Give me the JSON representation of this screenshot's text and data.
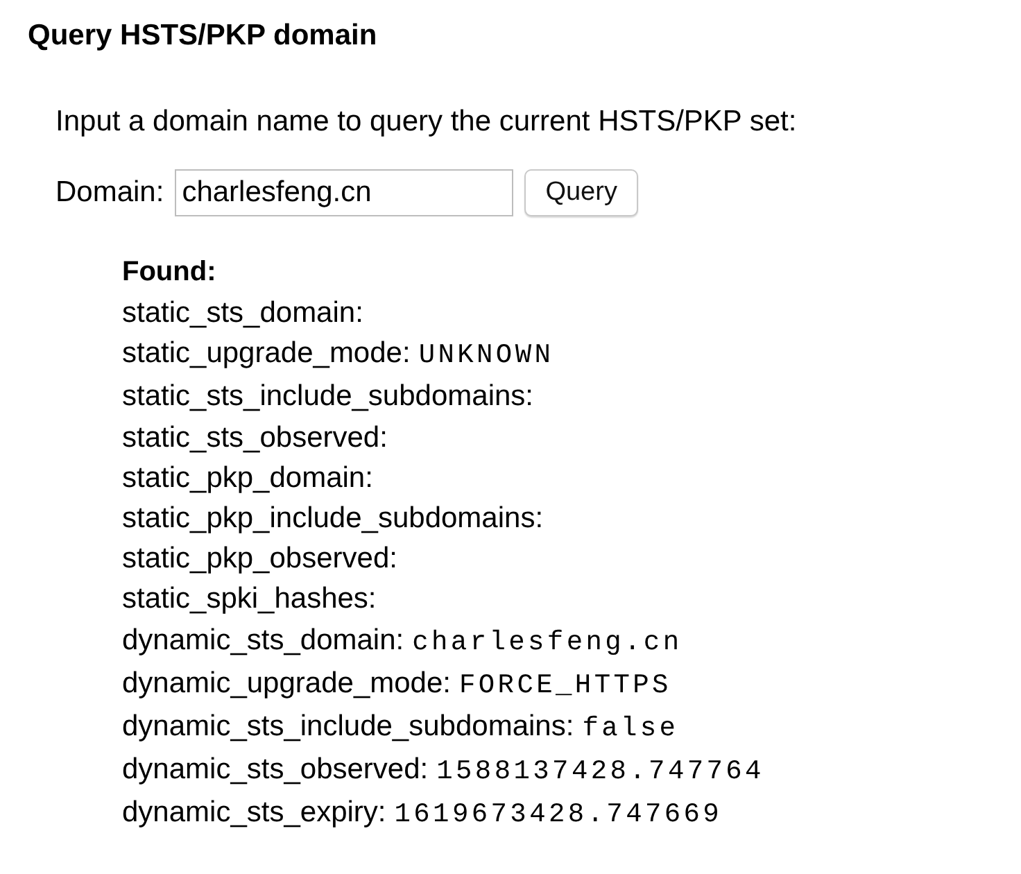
{
  "heading": "Query HSTS/PKP domain",
  "description": "Input a domain name to query the current HSTS/PKP set:",
  "domain_field": {
    "label": "Domain:",
    "value": "charlesfeng.cn"
  },
  "query_button": "Query",
  "result": {
    "title": "Found:",
    "entries": [
      {
        "label": "static_sts_domain:"
      },
      {
        "label": "static_upgrade_mode:",
        "value": "UNKNOWN"
      },
      {
        "label": "static_sts_include_subdomains:"
      },
      {
        "label": "static_sts_observed:"
      },
      {
        "label": "static_pkp_domain:"
      },
      {
        "label": "static_pkp_include_subdomains:"
      },
      {
        "label": "static_pkp_observed:"
      },
      {
        "label": "static_spki_hashes:"
      },
      {
        "label": "dynamic_sts_domain:",
        "value": "charlesfeng.cn"
      },
      {
        "label": "dynamic_upgrade_mode:",
        "value": "FORCE_HTTPS"
      },
      {
        "label": "dynamic_sts_include_subdomains:",
        "value": "false"
      },
      {
        "label": "dynamic_sts_observed:",
        "value": "1588137428.747764"
      },
      {
        "label": "dynamic_sts_expiry:",
        "value": "1619673428.747669"
      }
    ]
  }
}
